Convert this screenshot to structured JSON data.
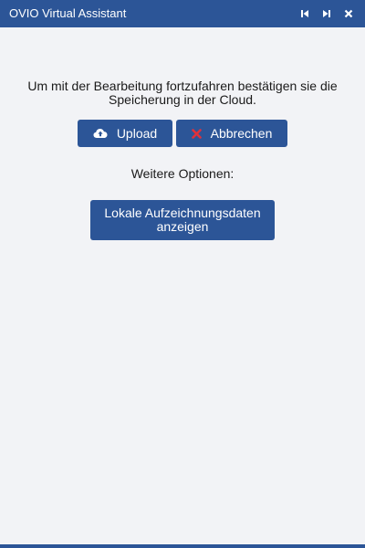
{
  "window": {
    "title": "OVIO Virtual Assistant",
    "controls": [
      "skip-back-icon",
      "skip-forward-icon",
      "close-icon"
    ]
  },
  "main": {
    "message": "Um mit der Bearbeitung fortzufahren bestätigen sie die Speicherung in der Cloud.",
    "upload_label": "Upload",
    "cancel_label": "Abbrechen",
    "options_label": "Weitere Optionen:",
    "local_data_label": "Lokale Aufzeichnungsdaten anzeigen"
  },
  "colors": {
    "accent": "#2c5597",
    "background": "#f2f3f6",
    "cancel_icon": "#e0313a"
  }
}
